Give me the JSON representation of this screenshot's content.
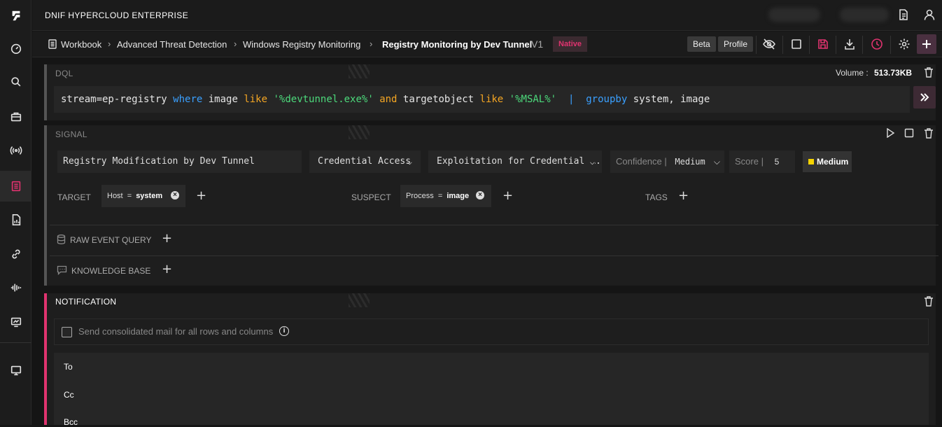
{
  "app": {
    "title": "DNIF HYPERCLOUD ENTERPRISE"
  },
  "breadcrumb": {
    "items": [
      "Workbook",
      "Advanced Threat Detection",
      "Windows Registry Monitoring"
    ],
    "current": "Registry Monitoring by Dev Tunnel",
    "version": "V1",
    "badge": "Native"
  },
  "toolbar": {
    "beta_label": "Beta",
    "profile_label": "Profile"
  },
  "dql": {
    "title": "DQL",
    "volume_label": "Volume :",
    "volume_value": "513.73KB",
    "query_tokens": [
      {
        "t": "stream=ep-registry ",
        "c": "#e6e6e6"
      },
      {
        "t": "where",
        "c": "#3aa0ff"
      },
      {
        "t": " image ",
        "c": "#e6e6e6"
      },
      {
        "t": "like",
        "c": "#f5a623"
      },
      {
        "t": " '%devtunnel.exe%' ",
        "c": "#4cd97b"
      },
      {
        "t": "and",
        "c": "#f5a623"
      },
      {
        "t": " targetobject ",
        "c": "#e6e6e6"
      },
      {
        "t": "like",
        "c": "#f5a623"
      },
      {
        "t": " '%MSAL%'",
        "c": "#4cd97b"
      },
      {
        "t": "  |  ",
        "c": "#3aa0ff"
      },
      {
        "t": "groupby",
        "c": "#3aa0ff"
      },
      {
        "t": " system, image",
        "c": "#e6e6e6"
      }
    ]
  },
  "signal": {
    "title": "SIGNAL",
    "name": "Registry Modification by Dev Tunnel",
    "tactic": "Credential Access",
    "technique": "Exploitation for Credential A...",
    "confidence_label": "Confidence |",
    "confidence_value": "Medium",
    "score_label": "Score |",
    "score_value": "5",
    "severity": "Medium",
    "target_label": "TARGET",
    "target_pill": {
      "key": "Host",
      "eq": "=",
      "value": "system"
    },
    "suspect_label": "SUSPECT",
    "suspect_pill": {
      "key": "Process",
      "eq": "=",
      "value": "image"
    },
    "tags_label": "TAGS",
    "raw_event_query_label": "RAW EVENT QUERY",
    "knowledge_base_label": "KNOWLEDGE BASE"
  },
  "notification": {
    "title": "NOTIFICATION",
    "consolidated_label": "Send consolidated mail for all rows and columns",
    "to_label": "To",
    "cc_label": "Cc",
    "bcc_label": "Bcc"
  },
  "colors": {
    "accent": "#e0336f",
    "severity_medium": "#f5d300"
  }
}
